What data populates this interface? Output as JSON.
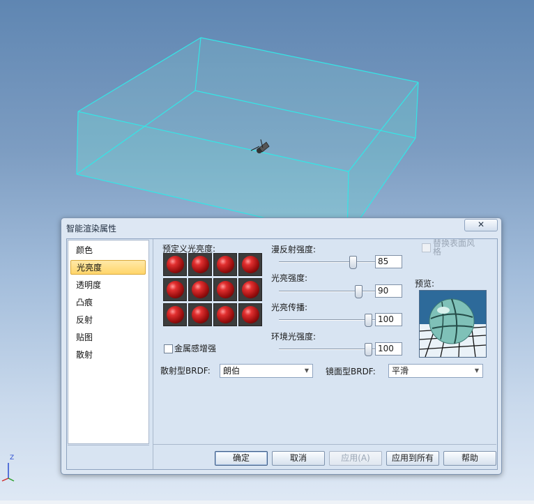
{
  "dialog": {
    "title": "智能渲染属性",
    "close_symbol": "✕"
  },
  "nav": {
    "items": [
      {
        "label": "颜色",
        "selected": false
      },
      {
        "label": "光亮度",
        "selected": true
      },
      {
        "label": "透明度",
        "selected": false
      },
      {
        "label": "凸痕",
        "selected": false
      },
      {
        "label": "反射",
        "selected": false
      },
      {
        "label": "贴图",
        "selected": false
      },
      {
        "label": "散射",
        "selected": false
      }
    ]
  },
  "presets": {
    "label": "预定义光亮度:",
    "count": 12
  },
  "metal": {
    "label": "金属感增强",
    "checked": false
  },
  "sliders": [
    {
      "label": "漫反射强度:",
      "value": "85",
      "fraction": 0.75
    },
    {
      "label": "光亮强度:",
      "value": "90",
      "fraction": 0.81
    },
    {
      "label": "光亮传播:",
      "value": "100",
      "fraction": 0.91
    },
    {
      "label": "环境光强度:",
      "value": "100",
      "fraction": 0.91
    }
  ],
  "replace_style": {
    "label": "替换表面风格",
    "checked": false,
    "enabled": false
  },
  "preview": {
    "label": "预览:"
  },
  "scatter_brdf": {
    "label": "散射型BRDF:",
    "value": "朗伯"
  },
  "mirror_brdf": {
    "label": "镜面型BRDF:",
    "value": "平滑"
  },
  "buttons": {
    "ok": "确定",
    "cancel": "取消",
    "apply": "应用(A)",
    "apply_all": "应用到所有",
    "help": "帮助"
  },
  "axes": {
    "z_label": "Z"
  },
  "colors": {
    "wireframe": "#34e6e6",
    "selection_highlight": "#ffd56a"
  }
}
